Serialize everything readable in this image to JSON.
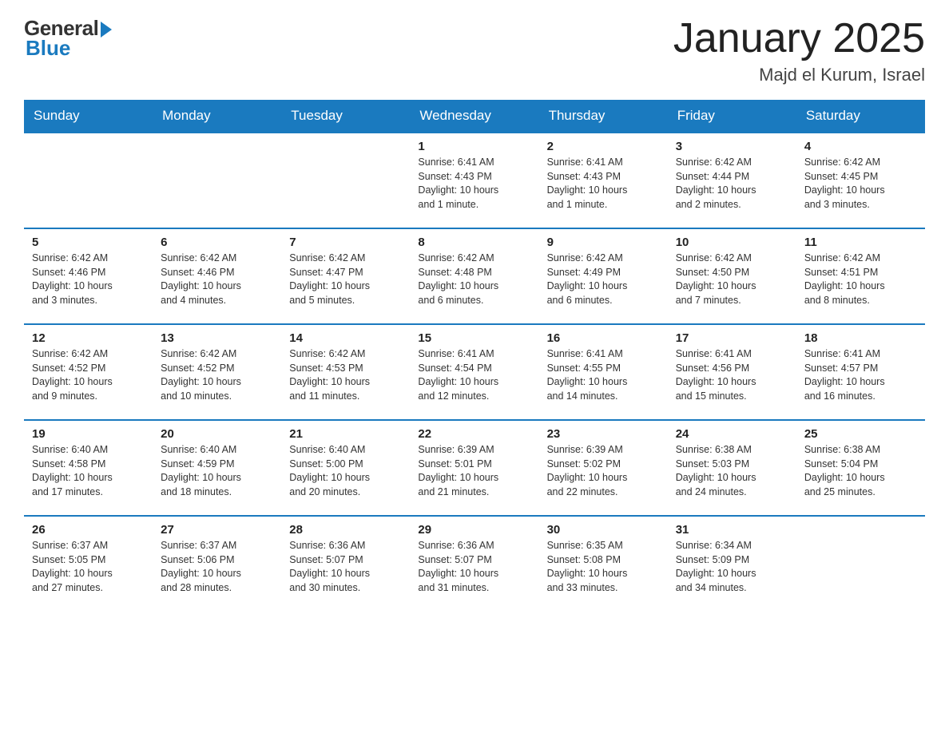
{
  "header": {
    "logo_general": "General",
    "logo_blue": "Blue",
    "month_title": "January 2025",
    "location": "Majd el Kurum, Israel"
  },
  "weekdays": [
    "Sunday",
    "Monday",
    "Tuesday",
    "Wednesday",
    "Thursday",
    "Friday",
    "Saturday"
  ],
  "weeks": [
    [
      {
        "day": "",
        "info": ""
      },
      {
        "day": "",
        "info": ""
      },
      {
        "day": "",
        "info": ""
      },
      {
        "day": "1",
        "info": "Sunrise: 6:41 AM\nSunset: 4:43 PM\nDaylight: 10 hours\nand 1 minute."
      },
      {
        "day": "2",
        "info": "Sunrise: 6:41 AM\nSunset: 4:43 PM\nDaylight: 10 hours\nand 1 minute."
      },
      {
        "day": "3",
        "info": "Sunrise: 6:42 AM\nSunset: 4:44 PM\nDaylight: 10 hours\nand 2 minutes."
      },
      {
        "day": "4",
        "info": "Sunrise: 6:42 AM\nSunset: 4:45 PM\nDaylight: 10 hours\nand 3 minutes."
      }
    ],
    [
      {
        "day": "5",
        "info": "Sunrise: 6:42 AM\nSunset: 4:46 PM\nDaylight: 10 hours\nand 3 minutes."
      },
      {
        "day": "6",
        "info": "Sunrise: 6:42 AM\nSunset: 4:46 PM\nDaylight: 10 hours\nand 4 minutes."
      },
      {
        "day": "7",
        "info": "Sunrise: 6:42 AM\nSunset: 4:47 PM\nDaylight: 10 hours\nand 5 minutes."
      },
      {
        "day": "8",
        "info": "Sunrise: 6:42 AM\nSunset: 4:48 PM\nDaylight: 10 hours\nand 6 minutes."
      },
      {
        "day": "9",
        "info": "Sunrise: 6:42 AM\nSunset: 4:49 PM\nDaylight: 10 hours\nand 6 minutes."
      },
      {
        "day": "10",
        "info": "Sunrise: 6:42 AM\nSunset: 4:50 PM\nDaylight: 10 hours\nand 7 minutes."
      },
      {
        "day": "11",
        "info": "Sunrise: 6:42 AM\nSunset: 4:51 PM\nDaylight: 10 hours\nand 8 minutes."
      }
    ],
    [
      {
        "day": "12",
        "info": "Sunrise: 6:42 AM\nSunset: 4:52 PM\nDaylight: 10 hours\nand 9 minutes."
      },
      {
        "day": "13",
        "info": "Sunrise: 6:42 AM\nSunset: 4:52 PM\nDaylight: 10 hours\nand 10 minutes."
      },
      {
        "day": "14",
        "info": "Sunrise: 6:42 AM\nSunset: 4:53 PM\nDaylight: 10 hours\nand 11 minutes."
      },
      {
        "day": "15",
        "info": "Sunrise: 6:41 AM\nSunset: 4:54 PM\nDaylight: 10 hours\nand 12 minutes."
      },
      {
        "day": "16",
        "info": "Sunrise: 6:41 AM\nSunset: 4:55 PM\nDaylight: 10 hours\nand 14 minutes."
      },
      {
        "day": "17",
        "info": "Sunrise: 6:41 AM\nSunset: 4:56 PM\nDaylight: 10 hours\nand 15 minutes."
      },
      {
        "day": "18",
        "info": "Sunrise: 6:41 AM\nSunset: 4:57 PM\nDaylight: 10 hours\nand 16 minutes."
      }
    ],
    [
      {
        "day": "19",
        "info": "Sunrise: 6:40 AM\nSunset: 4:58 PM\nDaylight: 10 hours\nand 17 minutes."
      },
      {
        "day": "20",
        "info": "Sunrise: 6:40 AM\nSunset: 4:59 PM\nDaylight: 10 hours\nand 18 minutes."
      },
      {
        "day": "21",
        "info": "Sunrise: 6:40 AM\nSunset: 5:00 PM\nDaylight: 10 hours\nand 20 minutes."
      },
      {
        "day": "22",
        "info": "Sunrise: 6:39 AM\nSunset: 5:01 PM\nDaylight: 10 hours\nand 21 minutes."
      },
      {
        "day": "23",
        "info": "Sunrise: 6:39 AM\nSunset: 5:02 PM\nDaylight: 10 hours\nand 22 minutes."
      },
      {
        "day": "24",
        "info": "Sunrise: 6:38 AM\nSunset: 5:03 PM\nDaylight: 10 hours\nand 24 minutes."
      },
      {
        "day": "25",
        "info": "Sunrise: 6:38 AM\nSunset: 5:04 PM\nDaylight: 10 hours\nand 25 minutes."
      }
    ],
    [
      {
        "day": "26",
        "info": "Sunrise: 6:37 AM\nSunset: 5:05 PM\nDaylight: 10 hours\nand 27 minutes."
      },
      {
        "day": "27",
        "info": "Sunrise: 6:37 AM\nSunset: 5:06 PM\nDaylight: 10 hours\nand 28 minutes."
      },
      {
        "day": "28",
        "info": "Sunrise: 6:36 AM\nSunset: 5:07 PM\nDaylight: 10 hours\nand 30 minutes."
      },
      {
        "day": "29",
        "info": "Sunrise: 6:36 AM\nSunset: 5:07 PM\nDaylight: 10 hours\nand 31 minutes."
      },
      {
        "day": "30",
        "info": "Sunrise: 6:35 AM\nSunset: 5:08 PM\nDaylight: 10 hours\nand 33 minutes."
      },
      {
        "day": "31",
        "info": "Sunrise: 6:34 AM\nSunset: 5:09 PM\nDaylight: 10 hours\nand 34 minutes."
      },
      {
        "day": "",
        "info": ""
      }
    ]
  ]
}
